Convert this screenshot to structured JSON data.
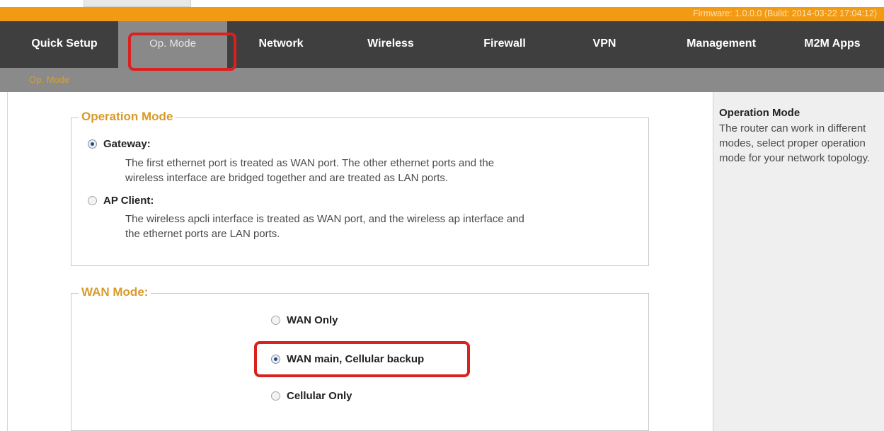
{
  "firmware": "Firmware: 1.0.0.0 (Build: 2014-03-22 17:04:12)",
  "nav": {
    "quick_setup": "Quick Setup",
    "op_mode": "Op. Mode",
    "network": "Network",
    "wireless": "Wireless",
    "firewall": "Firewall",
    "vpn": "VPN",
    "management": "Management",
    "m2m_apps": "M2M Apps"
  },
  "subnav": {
    "op_mode": "Op. Mode"
  },
  "operation_mode": {
    "legend": "Operation Mode",
    "gateway_label": "Gateway:",
    "gateway_desc_line1": "The first ethernet port is treated as WAN port. The other ethernet ports and the",
    "gateway_desc_line2": "wireless interface are bridged together and are treated as LAN ports.",
    "ap_client_label": "AP Client:",
    "ap_client_desc_line1": "The wireless apcli interface is treated as WAN port, and the wireless ap interface and",
    "ap_client_desc_line2": "the ethernet ports are LAN ports.",
    "selected": "Gateway"
  },
  "wan_mode": {
    "legend": "WAN Mode:",
    "wan_only": "WAN Only",
    "wan_main_cellular_backup": "WAN main, Cellular backup",
    "cellular_only": "Cellular Only",
    "selected": "WAN main, Cellular backup"
  },
  "help": {
    "title": "Operation Mode",
    "text": "The router can work in different modes, select proper operation mode for your network topology."
  },
  "colors": {
    "firmware_bar": "#f39a14",
    "nav_bar": "#3f3f3f",
    "nav_active": "#898989",
    "legend_text": "#d89a2a",
    "highlight": "#d9211f"
  }
}
